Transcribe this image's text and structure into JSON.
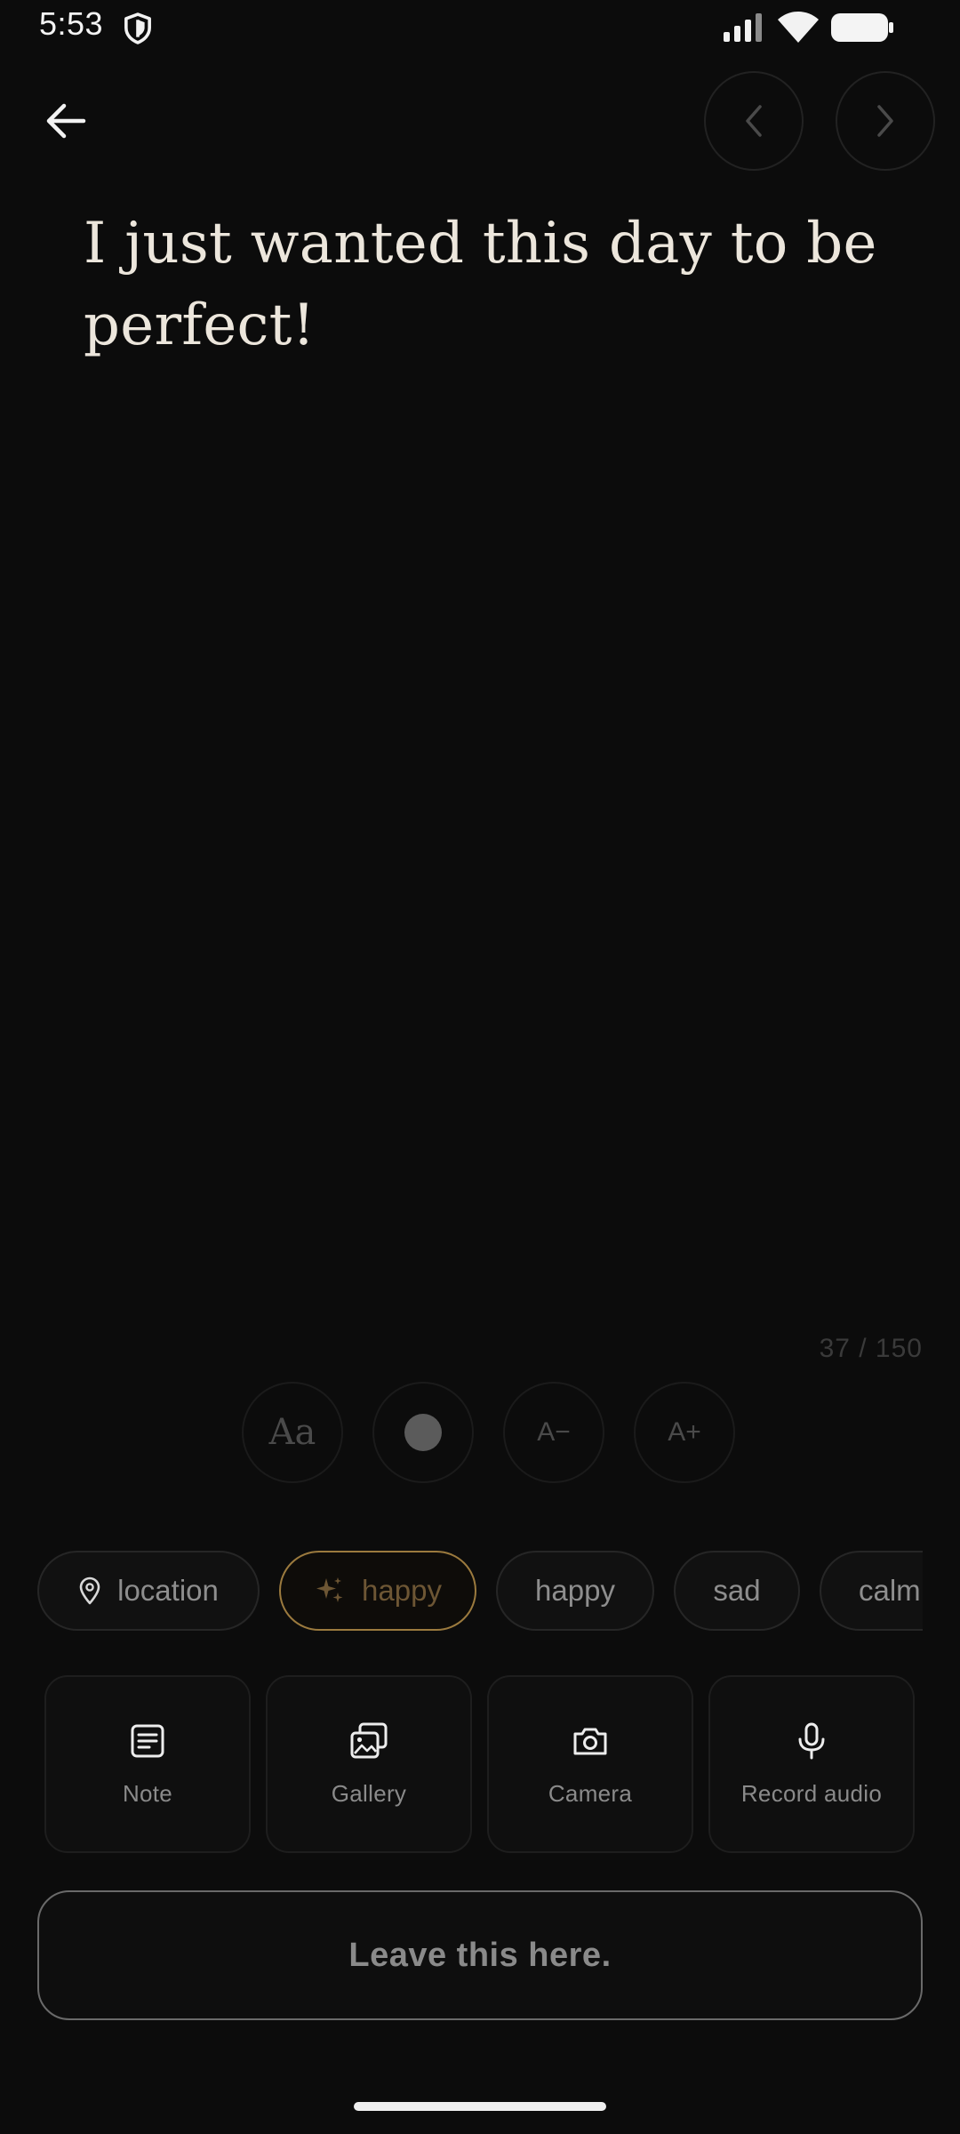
{
  "status_bar": {
    "time": "5:53",
    "icons": [
      "shield-icon",
      "signal-icon",
      "wifi-icon",
      "battery-icon"
    ]
  },
  "nav": {
    "back_icon": "arrow-left-icon",
    "prev_icon": "chevron-left-icon",
    "next_icon": "chevron-right-icon"
  },
  "entry": {
    "text": "I just wanted this day to be perfect!",
    "counter": "37 / 150"
  },
  "format_toolbar": {
    "font_label": "Aa",
    "color_icon": "color-dot-icon",
    "decrease_label": "A−",
    "increase_label": "A+"
  },
  "tags": {
    "location": "location",
    "ai_suggestion": "happy",
    "items": [
      "happy",
      "sad",
      "calm"
    ]
  },
  "attachments": [
    {
      "label": "Note",
      "icon": "note-icon"
    },
    {
      "label": "Gallery",
      "icon": "gallery-icon"
    },
    {
      "label": "Camera",
      "icon": "camera-icon"
    },
    {
      "label": "Record audio",
      "icon": "microphone-icon"
    }
  ],
  "submit_label": "Leave this here.",
  "colors": {
    "background": "#0c0c0c",
    "text": "#ece6dc",
    "accent_gold": "#9b7a3e",
    "muted": "#8a8a8a"
  }
}
